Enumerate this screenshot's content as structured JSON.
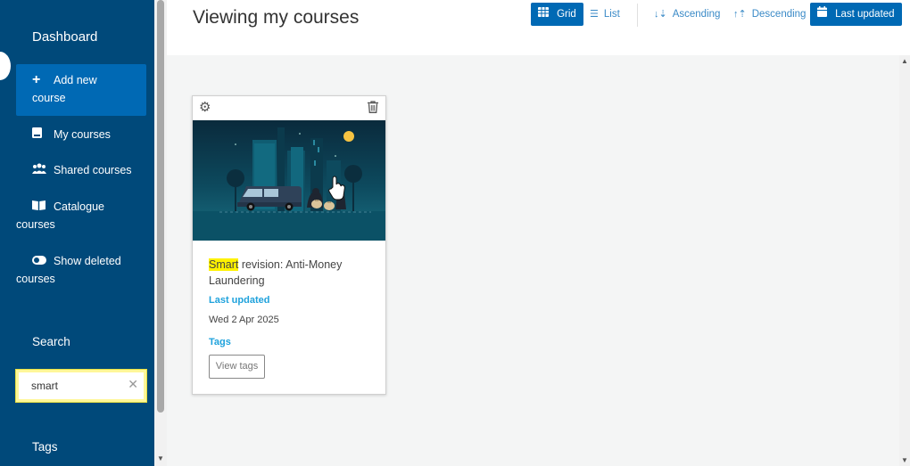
{
  "sidebar": {
    "title": "Dashboard",
    "items": [
      {
        "label_line1": "Add new",
        "label_line2": "course",
        "icon": "plus-icon",
        "active": true
      },
      {
        "label_line1": "My courses",
        "label_line2": "",
        "icon": "book-icon"
      },
      {
        "label_line1": "Shared courses",
        "label_line2": "",
        "icon": "users-icon"
      },
      {
        "label_line1": "Catalogue",
        "label_line2": "courses",
        "icon": "open-book-icon"
      },
      {
        "label_line1": "Show deleted",
        "label_line2": "courses",
        "icon": "toggle-icon"
      }
    ],
    "search_heading": "Search",
    "search_value": "smart",
    "tags_heading": "Tags"
  },
  "header": {
    "title": "Viewing my courses",
    "view_grid": "Grid",
    "view_list": "List",
    "sort_ascending": "Ascending",
    "sort_descending": "Descending",
    "sort_last_updated": "Last updated"
  },
  "course": {
    "title_highlight": "Smart",
    "title_rest": " revision: Anti-Money Laundering",
    "last_updated_label": "Last updated",
    "last_updated_value": "Wed 2 Apr 2025",
    "tags_label": "Tags",
    "view_tags_button": "View tags"
  },
  "colors": {
    "sidebar_bg": "#00497a",
    "accent": "#0069b4",
    "link": "#3a8ac7",
    "label": "#1fa2dc",
    "highlight": "#fff200"
  }
}
